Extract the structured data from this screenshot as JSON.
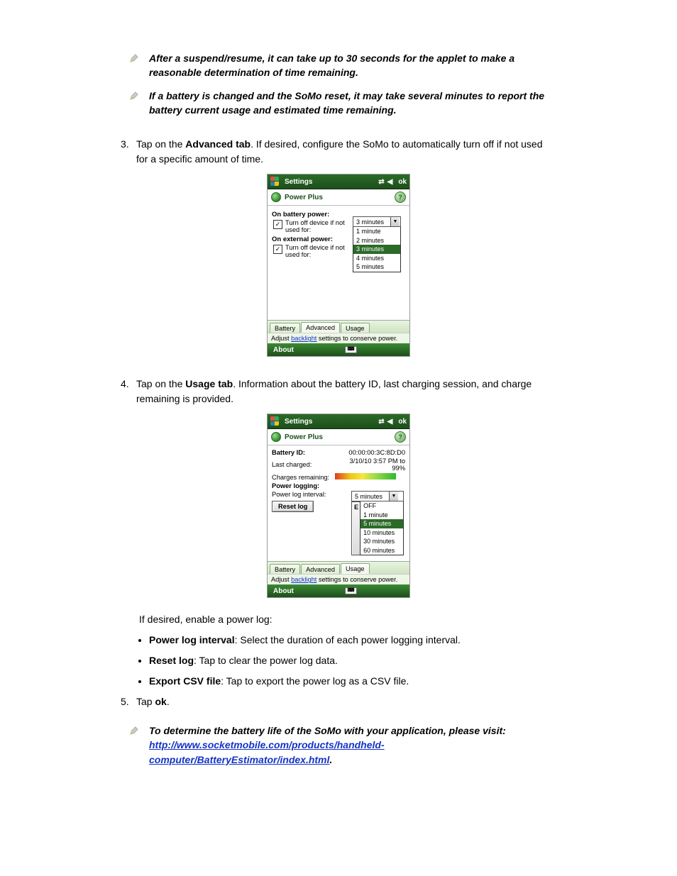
{
  "notes": {
    "n1": "After a suspend/resume, it can take up to 30 seconds for the applet to make a reasonable determination of time remaining.",
    "n2": "If a battery is changed and the SoMo reset, it may take several minutes to report the battery current usage and estimated time remaining.",
    "n3_pre": "To determine the battery life of the SoMo with your application, please visit: ",
    "n3_link": "http://www.socketmobile.com/products/handheld-computer/BatteryEstimator/index.html",
    "n3_post": "."
  },
  "steps": {
    "s3": {
      "num": "3.",
      "pre": "Tap on the ",
      "bold": "Advanced tab",
      "post": ". If desired, configure the SoMo to automatically turn off if not used for a specific amount of time."
    },
    "s4": {
      "num": "4.",
      "pre": "Tap on the ",
      "bold": "Usage tab",
      "post": ". Information about the battery ID, last charging session, and charge remaining is provided."
    },
    "s5": {
      "num": "5.",
      "pre": "Tap ",
      "bold": "ok",
      "post": "."
    }
  },
  "powerlog": {
    "intro": "If desired, enable a power log:",
    "b1b": "Power log interval",
    "b1": ": Select the duration of each power logging interval.",
    "b2b": "Reset log",
    "b2": ": Tap to clear the power log data.",
    "b3b": "Export CSV file",
    "b3": ": Tap to export the power log as a CSV file."
  },
  "shot_common": {
    "settings": "Settings",
    "ok": "ok",
    "powerplus": "Power Plus",
    "tabs": {
      "battery": "Battery",
      "advanced": "Advanced",
      "usage": "Usage"
    },
    "hint_pre": "Adjust ",
    "hint_link": "backlight",
    "hint_post": " settings to conserve power.",
    "about": "About"
  },
  "shot1": {
    "h1": "On battery power:",
    "chk_label": "Turn off device if not used for:",
    "h2": "On external power:",
    "combo_value": "3 minutes",
    "options": [
      "1 minute",
      "2 minutes",
      "3 minutes",
      "4 minutes",
      "5 minutes"
    ],
    "selected_index": 2
  },
  "shot2": {
    "batt_id_lbl": "Battery ID:",
    "batt_id": "00:00:00:3C:8D:D0",
    "last_lbl": "Last charged:",
    "last": "3/10/10 3:57 PM to 99%",
    "charges_lbl": "Charges remaining:",
    "logging_lbl": "Power logging:",
    "interval_lbl": "Power log interval:",
    "combo_value": "5 minutes",
    "reset": "Reset log",
    "export_prefix": "E",
    "options": [
      "OFF",
      "1 minute",
      "5 minutes",
      "10 minutes",
      "30 minutes",
      "60 minutes"
    ],
    "selected_index": 2
  }
}
